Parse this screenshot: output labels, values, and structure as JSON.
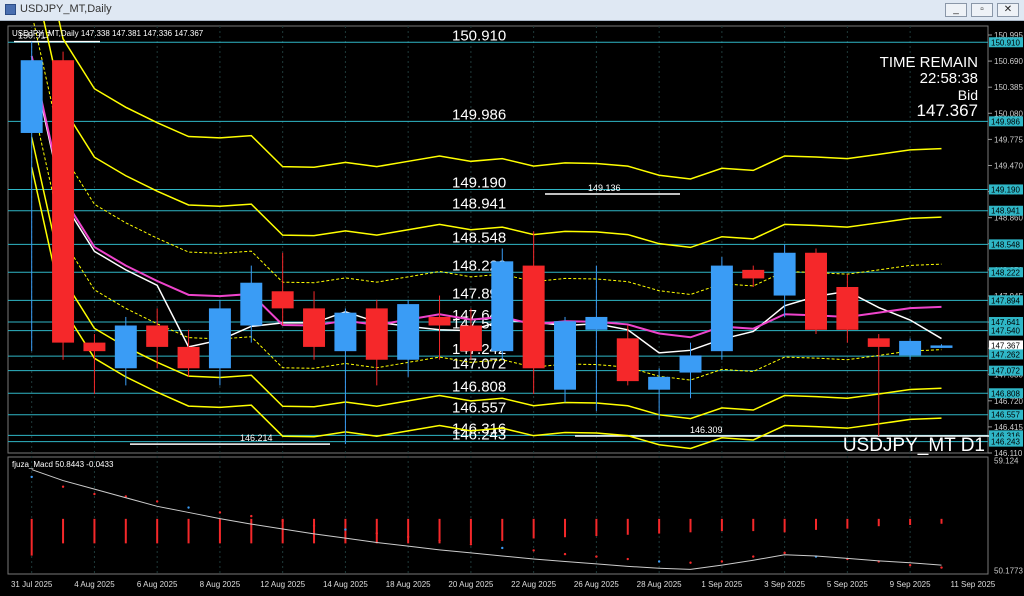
{
  "window": {
    "title": "USDJPY_MT,Daily",
    "minimize_label": "_",
    "restore_label": "▫",
    "close_label": "✕"
  },
  "main_header": "USDJPY_MT,Daily  147.338 147.381 147.336 147.367",
  "macd_header": "fjuza_Macd 50.8443  -0.0433",
  "symbol_watermark": "USDJPY_MT D1",
  "info": {
    "time_remain_label": "TIME REMAIN",
    "time_remain": "22:58:38",
    "bid_label": "Bid",
    "bid": "147.367"
  },
  "colors": {
    "bull": "#3a9cf5",
    "bear": "#f5282a",
    "grid": "#1f3d3d",
    "level": "#2fb6c6",
    "envelope": "#ffff00",
    "ma_white": "#ffffff",
    "ma_magenta": "#ee44cc",
    "axis_text": "#ffffff"
  },
  "chart_data": [
    {
      "type": "candlestick",
      "title": "USDJPY_MT,Daily",
      "x_labels": [
        "31 Jul 2025",
        "4 Aug 2025",
        "6 Aug 2025",
        "8 Aug 2025",
        "12 Aug 2025",
        "14 Aug 2025",
        "18 Aug 2025",
        "20 Aug 2025",
        "22 Aug 2025",
        "26 Aug 2025",
        "28 Aug 2025",
        "1 Sep 2025",
        "3 Sep 2025",
        "5 Sep 2025",
        "9 Sep 2025",
        "11 Sep 2025"
      ],
      "ylim": [
        146.11,
        151.1
      ],
      "y_ticks": [
        150.995,
        150.69,
        150.385,
        150.08,
        149.775,
        149.47,
        149.165,
        148.86,
        148.555,
        148.25,
        147.945,
        147.64,
        147.335,
        147.03,
        146.72,
        146.415,
        146.11
      ],
      "axis_flags": [
        "150.910",
        "149.986",
        "149.190",
        "148.941",
        "148.548",
        "148.222",
        "147.894",
        "147.641",
        "147.540",
        "147.367",
        "147.262",
        "147.072",
        "146.808",
        "146.557",
        "146.316",
        "146.243"
      ],
      "levels": [
        {
          "value": 150.91,
          "label": "150.910"
        },
        {
          "value": 149.986,
          "label": "149.986"
        },
        {
          "value": 149.19,
          "label": "149.190"
        },
        {
          "value": 148.941,
          "label": "148.941"
        },
        {
          "value": 148.548,
          "label": "148.548"
        },
        {
          "value": 148.222,
          "label": "148.222"
        },
        {
          "value": 147.894,
          "label": "147.894"
        },
        {
          "value": 147.641,
          "label": "147.641"
        },
        {
          "value": 147.54,
          "label": "147.540"
        },
        {
          "value": 147.242,
          "label": "147.242"
        },
        {
          "value": 147.072,
          "label": "147.072"
        },
        {
          "value": 146.808,
          "label": "146.808"
        },
        {
          "value": 146.557,
          "label": "146.557"
        },
        {
          "value": 146.316,
          "label": "146.316"
        },
        {
          "value": 146.243,
          "label": "146.243"
        }
      ],
      "annotations": [
        {
          "value": 150.917,
          "label": "150.917"
        },
        {
          "value": 149.136,
          "label": "149.136"
        },
        {
          "value": 146.214,
          "label": "146.214"
        },
        {
          "value": 146.309,
          "label": "146.309"
        }
      ],
      "candles": [
        {
          "o": 149.85,
          "h": 150.917,
          "l": 147.3,
          "c": 150.7
        },
        {
          "o": 150.7,
          "h": 150.8,
          "l": 147.2,
          "c": 147.4
        },
        {
          "o": 147.4,
          "h": 147.5,
          "l": 146.8,
          "c": 147.3
        },
        {
          "o": 147.1,
          "h": 147.7,
          "l": 146.9,
          "c": 147.6
        },
        {
          "o": 147.6,
          "h": 147.8,
          "l": 147.1,
          "c": 147.35
        },
        {
          "o": 147.35,
          "h": 147.55,
          "l": 147.0,
          "c": 147.1
        },
        {
          "o": 147.1,
          "h": 147.9,
          "l": 146.9,
          "c": 147.8
        },
        {
          "o": 147.6,
          "h": 148.3,
          "l": 147.4,
          "c": 148.1
        },
        {
          "o": 148.0,
          "h": 148.45,
          "l": 147.6,
          "c": 147.8
        },
        {
          "o": 147.8,
          "h": 148.0,
          "l": 147.2,
          "c": 147.35
        },
        {
          "o": 147.3,
          "h": 147.8,
          "l": 146.214,
          "c": 147.75
        },
        {
          "o": 147.8,
          "h": 147.9,
          "l": 146.9,
          "c": 147.2
        },
        {
          "o": 147.2,
          "h": 147.9,
          "l": 147.0,
          "c": 147.85
        },
        {
          "o": 147.7,
          "h": 147.95,
          "l": 147.2,
          "c": 147.6
        },
        {
          "o": 147.6,
          "h": 147.8,
          "l": 147.2,
          "c": 147.3
        },
        {
          "o": 147.3,
          "h": 148.5,
          "l": 147.2,
          "c": 148.35
        },
        {
          "o": 148.3,
          "h": 148.7,
          "l": 146.8,
          "c": 147.1
        },
        {
          "o": 146.85,
          "h": 147.7,
          "l": 146.7,
          "c": 147.65
        },
        {
          "o": 147.55,
          "h": 148.3,
          "l": 146.6,
          "c": 147.7
        },
        {
          "o": 147.45,
          "h": 147.6,
          "l": 146.9,
          "c": 146.95
        },
        {
          "o": 146.85,
          "h": 147.1,
          "l": 146.5,
          "c": 147.0
        },
        {
          "o": 147.05,
          "h": 147.4,
          "l": 146.75,
          "c": 147.25
        },
        {
          "o": 147.3,
          "h": 148.4,
          "l": 147.2,
          "c": 148.3
        },
        {
          "o": 148.25,
          "h": 148.3,
          "l": 148.05,
          "c": 148.15
        },
        {
          "o": 147.95,
          "h": 148.55,
          "l": 147.7,
          "c": 148.45
        },
        {
          "o": 148.45,
          "h": 148.5,
          "l": 147.5,
          "c": 147.55
        },
        {
          "o": 148.05,
          "h": 148.2,
          "l": 147.4,
          "c": 147.55
        },
        {
          "o": 147.45,
          "h": 147.5,
          "l": 146.309,
          "c": 147.35
        },
        {
          "o": 147.25,
          "h": 147.45,
          "l": 147.2,
          "c": 147.42
        },
        {
          "o": 147.338,
          "h": 147.381,
          "l": 147.336,
          "c": 147.367
        }
      ]
    },
    {
      "type": "macd",
      "title": "fjuza_Macd 50.8443 -0.0433",
      "y_ticks": [
        59.124,
        50.1773
      ],
      "line_a": [
        58.4,
        57.5,
        56.8,
        56.1,
        55.4,
        54.9,
        54.4,
        53.95,
        53.55,
        53.15,
        52.8,
        52.45,
        52.15,
        51.85,
        51.6,
        51.35,
        51.1,
        50.9,
        50.7,
        50.5,
        50.35,
        50.25,
        50.6,
        51.0,
        51.45,
        51.35,
        51.15,
        50.95,
        50.8,
        50.6
      ],
      "bars": [
        [
          0,
          3.0
        ],
        [
          1,
          2.0
        ],
        [
          2,
          2.0
        ],
        [
          3,
          2.0
        ],
        [
          4,
          2.0
        ],
        [
          5,
          2.0
        ],
        [
          6,
          2.0
        ],
        [
          7,
          2.0
        ],
        [
          8,
          2.0
        ],
        [
          9,
          2.0
        ],
        [
          10,
          2.0
        ],
        [
          11,
          2.0
        ],
        [
          12,
          2.0
        ],
        [
          13,
          2.0
        ],
        [
          14,
          2.0
        ],
        [
          15,
          1.8
        ],
        [
          16,
          1.6
        ],
        [
          17,
          1.5
        ],
        [
          18,
          1.4
        ],
        [
          19,
          1.3
        ],
        [
          20,
          1.2
        ],
        [
          21,
          1.1
        ],
        [
          22,
          1.0
        ],
        [
          23,
          1.0
        ],
        [
          24,
          1.1
        ],
        [
          25,
          0.9
        ],
        [
          26,
          0.8
        ],
        [
          27,
          0.6
        ],
        [
          28,
          0.5
        ],
        [
          29,
          0.4
        ]
      ],
      "dots": [
        57.8,
        57.0,
        56.4,
        56.2,
        55.8,
        55.3,
        54.9,
        54.6,
        54.2,
        53.8,
        53.5,
        53.2,
        52.9,
        52.6,
        52.3,
        52.0,
        51.8,
        51.5,
        51.3,
        51.1,
        50.9,
        50.8,
        50.9,
        51.3,
        51.6,
        51.3,
        51.1,
        50.9,
        50.6,
        50.4
      ]
    }
  ]
}
